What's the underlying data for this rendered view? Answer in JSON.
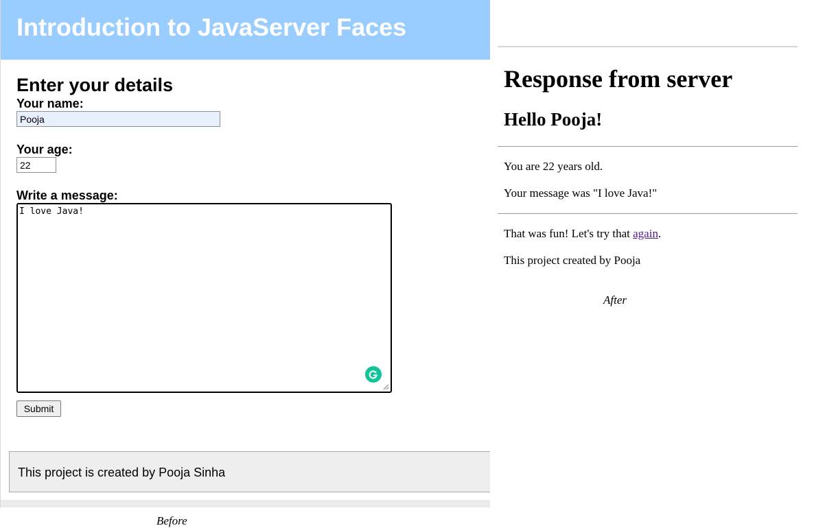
{
  "before": {
    "banner_title": "Introduction to JavaServer Faces",
    "form_title": "Enter your details",
    "name_label": "Your name:",
    "name_value": "Pooja",
    "age_label": "Your age:",
    "age_value": "22",
    "message_label": "Write a message:",
    "message_value": "I love Java!",
    "submit_label": "Submit",
    "footer_text": "This project is created by Pooja Sinha",
    "caption": "Before",
    "banner_color": "#99ccff"
  },
  "after": {
    "title": "Response from server",
    "greeting": "Hello Pooja!",
    "age_line": "You are 22 years old.",
    "message_line": "Your message was \"I love Java!\"",
    "fun_prefix": "That was fun! Let's try that ",
    "again_link": "again",
    "fun_suffix": ".",
    "credit_line": "This project created by Pooja",
    "caption": "After",
    "link_color": "#551a8b"
  },
  "icons": [
    "grammarly-icon",
    "resize-grip-icon"
  ]
}
